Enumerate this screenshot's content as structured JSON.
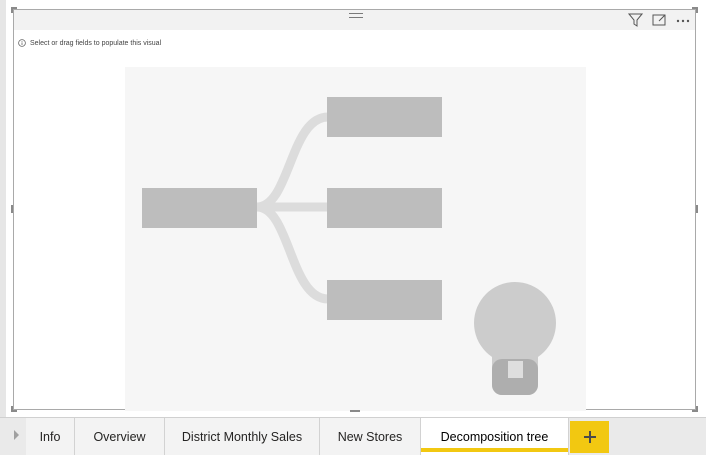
{
  "canvas": {
    "hint_text": "Select or drag fields to populate this visual"
  },
  "header_icons": {
    "filter": "filter-icon",
    "focus_mode": "focus-mode-icon",
    "more_options": "more-options-icon"
  },
  "tabs": [
    {
      "label": "Info",
      "active": false
    },
    {
      "label": "Overview",
      "active": false
    },
    {
      "label": "District Monthly Sales",
      "active": false
    },
    {
      "label": "New Stores",
      "active": false
    },
    {
      "label": "Decomposition tree",
      "active": true
    }
  ],
  "add_tab_label": "+",
  "colors": {
    "accent": "#f2c811",
    "placeholder_box": "#bdbdbd",
    "connector": "#dcdcdc",
    "bulb": "#cccccc",
    "tab_bar": "#eaeaea"
  }
}
